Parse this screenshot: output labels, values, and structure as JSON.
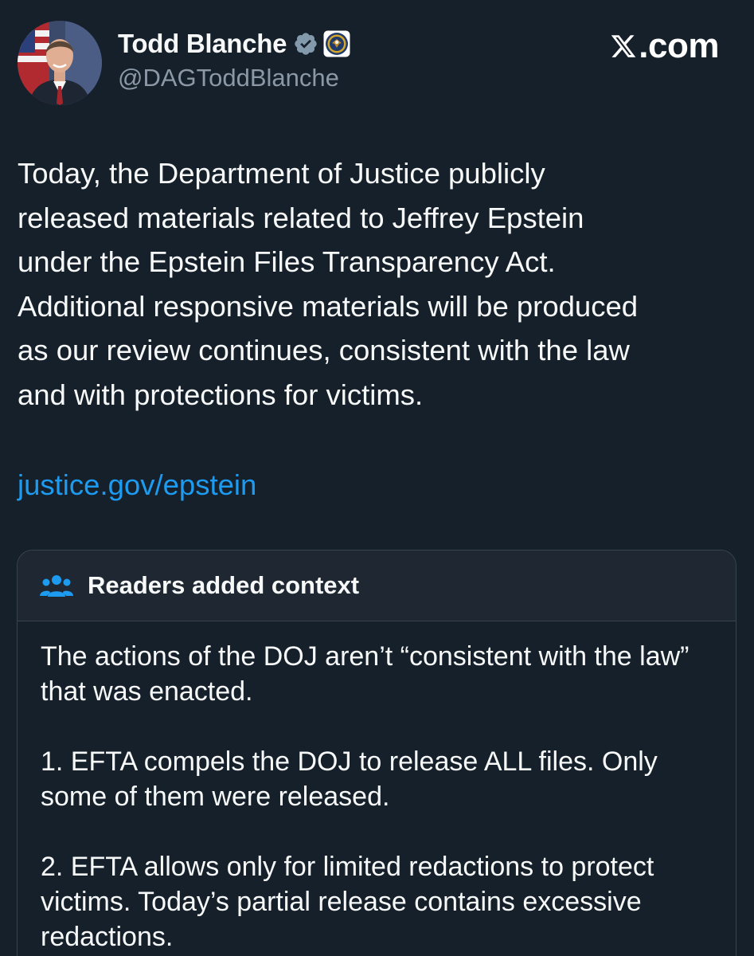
{
  "author": {
    "display_name": "Todd Blanche",
    "handle": "@DAGToddBlanche"
  },
  "brand": {
    "label": ".com"
  },
  "tweet": {
    "text": "Today, the Department of Justice publicly\nreleased materials related to Jeffrey Epstein\nunder the Epstein Files Transparency Act.\nAdditional responsive materials will be produced\nas our review continues, consistent with the law\nand with protections for victims.",
    "link": "justice.gov/epstein"
  },
  "community_note": {
    "title": "Readers added context",
    "paragraphs": [
      "The actions of the DOJ aren’t “consistent with the law” that was enacted.",
      "1. EFTA compels the DOJ to release ALL files. Only some of them were released.",
      "2. EFTA allows only for limited redactions to protect victims. Today’s partial release contains excessive redactions."
    ]
  },
  "colors": {
    "background": "#15202b",
    "link": "#1d9bf0",
    "secondary_text": "#8b98a5",
    "border": "#38444d",
    "note_header_bg": "#1e2732"
  },
  "icons": {
    "verified": "verified-badge-icon",
    "org": "doj-seal-icon",
    "brand": "x-logo-icon",
    "note": "people-icon"
  }
}
